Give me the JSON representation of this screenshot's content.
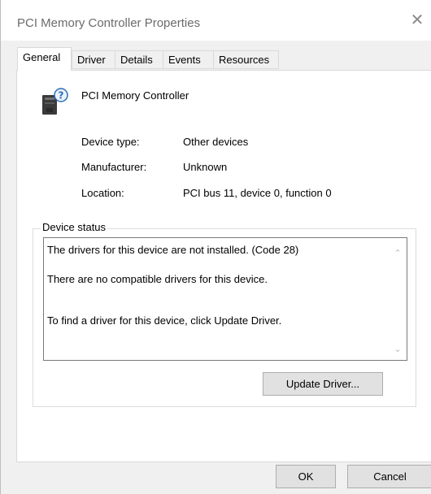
{
  "window": {
    "title": "PCI Memory Controller Properties",
    "close_glyph": "✕"
  },
  "tabs": [
    {
      "label": "General",
      "active": true
    },
    {
      "label": "Driver",
      "active": false
    },
    {
      "label": "Details",
      "active": false
    },
    {
      "label": "Events",
      "active": false
    },
    {
      "label": "Resources",
      "active": false
    }
  ],
  "general": {
    "device_icon": "unknown-device-icon",
    "device_name": "PCI Memory Controller",
    "properties": [
      {
        "label": "Device type:",
        "value": "Other devices"
      },
      {
        "label": "Manufacturer:",
        "value": "Unknown"
      },
      {
        "label": "Location:",
        "value": "PCI bus 11, device 0, function 0"
      }
    ],
    "device_status": {
      "legend": "Device status",
      "lines": [
        "The drivers for this device are not installed. (Code 28)",
        "There are no compatible drivers for this device.",
        "To find a driver for this device, click Update Driver."
      ]
    },
    "update_driver_label": "Update Driver..."
  },
  "footer": {
    "ok_label": "OK",
    "cancel_label": "Cancel"
  },
  "colors": {
    "accent": "#0078d7",
    "window_bg": "#f0f0f0",
    "panel_bg": "#ffffff"
  }
}
